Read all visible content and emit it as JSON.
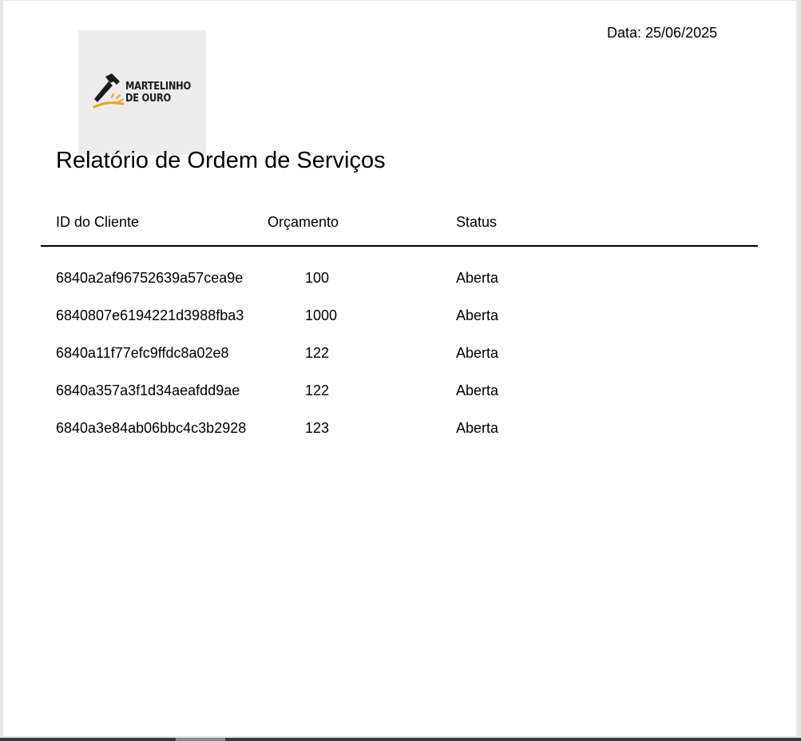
{
  "header": {
    "date_label": "Data: 25/06/2025"
  },
  "logo": {
    "text": "MARTELINHO\nDE OURO",
    "icon": "hammer-icon",
    "colors": {
      "hammer": "#1b1b1b",
      "spark": "#e8a11a",
      "background": "#ececec"
    }
  },
  "report": {
    "title": "Relatório de Ordem de Serviços"
  },
  "table": {
    "columns": [
      "ID do Cliente",
      "Orçamento",
      "Status"
    ],
    "rows": [
      {
        "id": "6840a2af96752639a57cea9e",
        "budget": "100",
        "status": "Aberta"
      },
      {
        "id": "6840807e6194221d3988fba3",
        "budget": "1000",
        "status": "Aberta"
      },
      {
        "id": "6840a11f77efc9ffdc8a02e8",
        "budget": "122",
        "status": "Aberta"
      },
      {
        "id": "6840a357a3f1d34aeafdd9ae",
        "budget": "122",
        "status": "Aberta"
      },
      {
        "id": "6840a3e84ab06bbc4c3b2928",
        "budget": "123",
        "status": "Aberta"
      }
    ]
  }
}
